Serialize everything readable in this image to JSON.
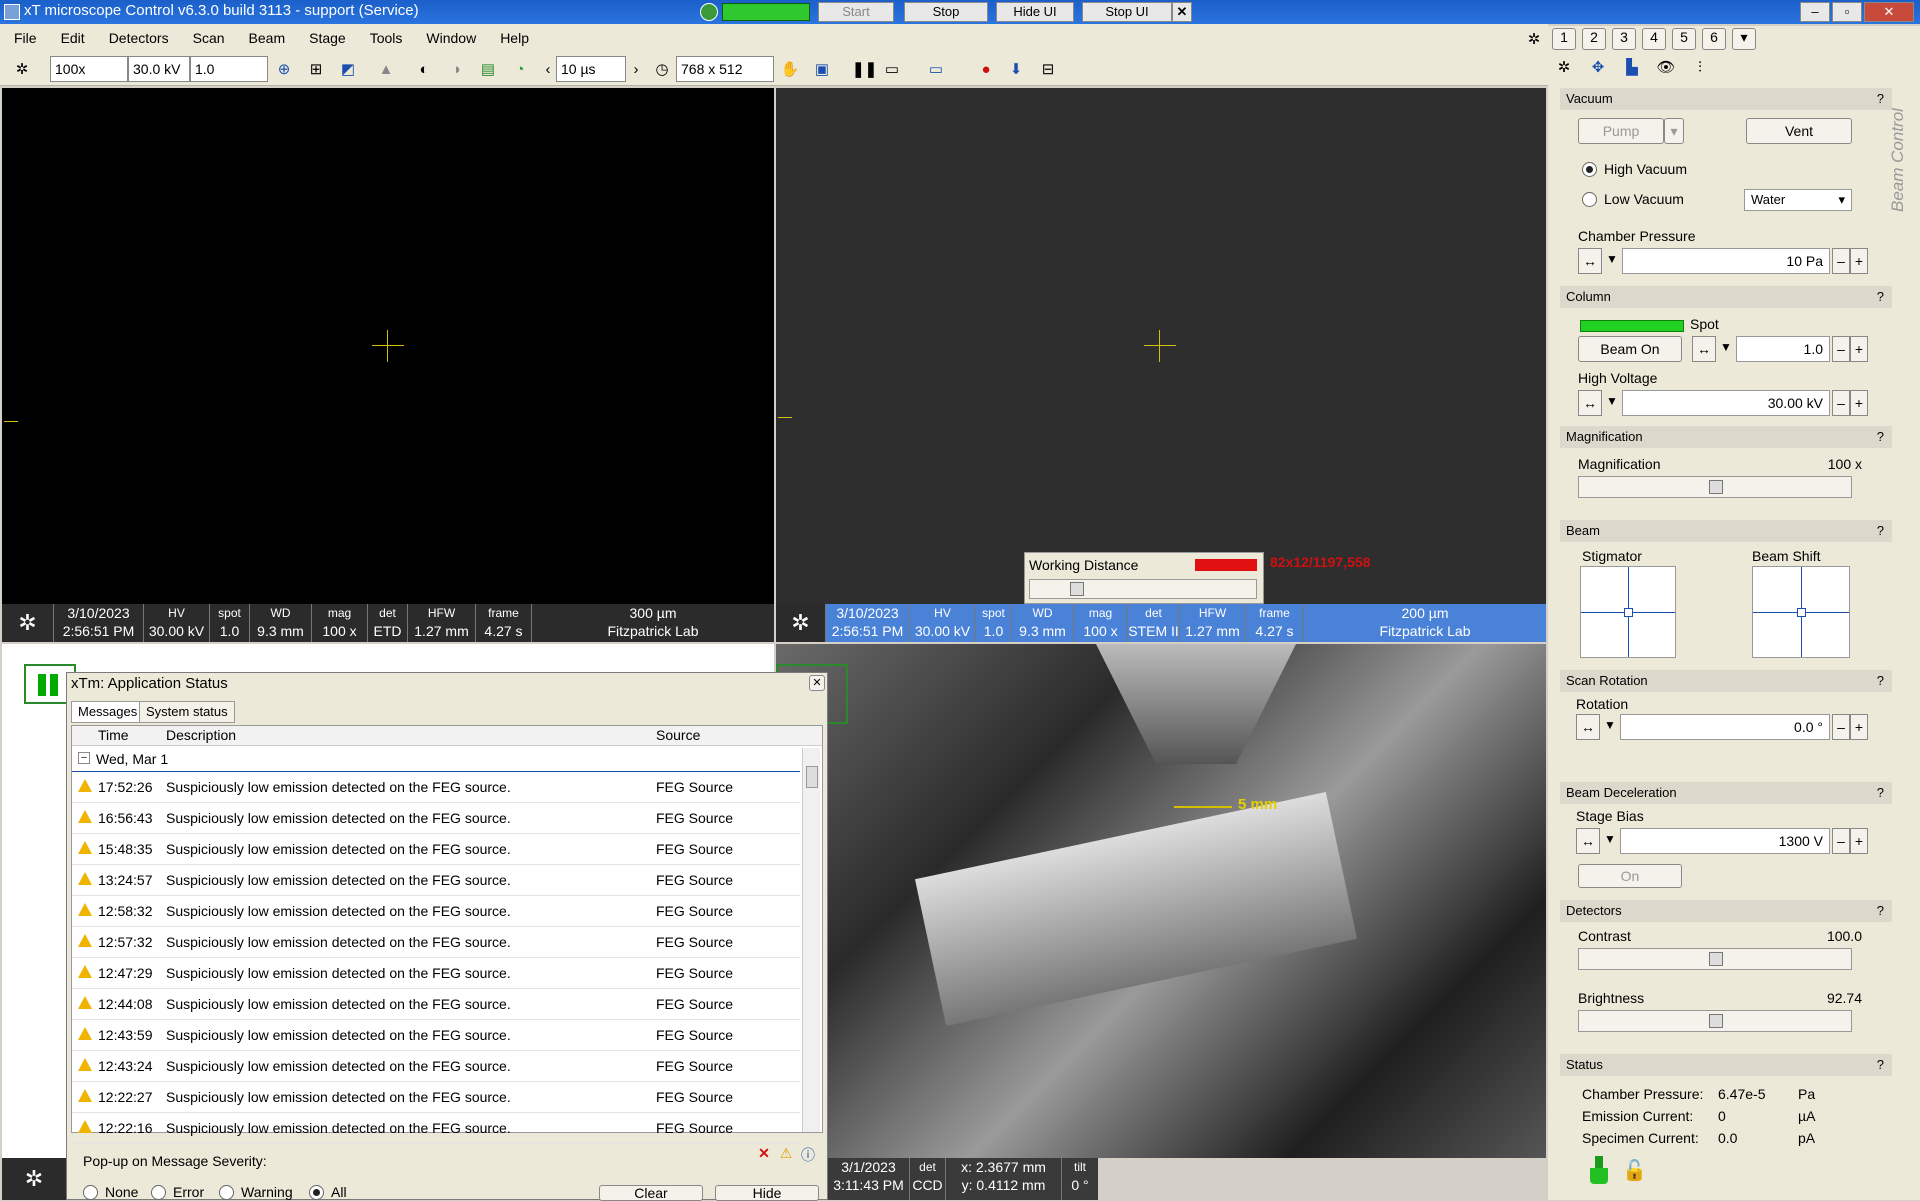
{
  "window": {
    "title": "xT microscope Control v6.3.0 build 3113 - support (Service)",
    "buttons": [
      "Start",
      "Stop",
      "Hide UI",
      "Stop UI"
    ]
  },
  "menu": [
    "File",
    "Edit",
    "Detectors",
    "Scan",
    "Beam",
    "Stage",
    "Tools",
    "Window",
    "Help"
  ],
  "toolbar": {
    "mag": "100x",
    "hv": "30.0 kV",
    "spot": "1.0",
    "dwell": "10 µs",
    "resolution": "768 x 512"
  },
  "quad_tabs": [
    "1",
    "2",
    "3",
    "4",
    "5",
    "6"
  ],
  "pane1": {
    "date": "3/10/2023",
    "time": "2:56:51 PM",
    "hv_k": "HV",
    "hv": "30.00 kV",
    "spot_k": "spot",
    "spot": "1.0",
    "wd_k": "WD",
    "wd": "9.3 mm",
    "mag_k": "mag",
    "mag": "100 x",
    "det_k": "det",
    "det": "ETD",
    "hfw_k": "HFW",
    "hfw": "1.27 mm",
    "frame_k": "frame",
    "frame": "4.27 s",
    "scale": "300 µm",
    "lab": "Fitzpatrick Lab"
  },
  "pane2": {
    "date": "3/10/2023",
    "time": "2:56:51 PM",
    "hv_k": "HV",
    "hv": "30.00 kV",
    "spot_k": "spot",
    "spot": "1.0",
    "wd_k": "WD",
    "wd": "9.3 mm",
    "mag_k": "mag",
    "mag": "100 x",
    "det_k": "det",
    "det": "STEM II",
    "hfw_k": "HFW",
    "hfw": "1.27 mm",
    "frame_k": "frame",
    "frame": "4.27 s",
    "scale": "200 µm",
    "lab": "Fitzpatrick Lab"
  },
  "wd_popup": {
    "title": "Working Distance",
    "readout": "82x12/1197,558"
  },
  "pane4": {
    "scale": "5 mm",
    "date": "3/1/2023",
    "time": "3:11:43 PM",
    "det_k": "det",
    "det": "CCD",
    "x": "x: 2.3677 mm",
    "y": "y: 0.4112 mm",
    "tilt_k": "tilt",
    "tilt": "0 °"
  },
  "dialog": {
    "title": "xTm: Application Status",
    "tabs": [
      "Messages",
      "System status"
    ],
    "columns": [
      "Time",
      "Description",
      "Source"
    ],
    "group": "Wed, Mar 1",
    "rows": [
      {
        "time": "17:52:26",
        "desc": "Suspiciously low emission detected on the FEG source.",
        "src": "FEG Source"
      },
      {
        "time": "16:56:43",
        "desc": "Suspiciously low emission detected on the FEG source.",
        "src": "FEG Source"
      },
      {
        "time": "15:48:35",
        "desc": "Suspiciously low emission detected on the FEG source.",
        "src": "FEG Source"
      },
      {
        "time": "13:24:57",
        "desc": "Suspiciously low emission detected on the FEG source.",
        "src": "FEG Source"
      },
      {
        "time": "12:58:32",
        "desc": "Suspiciously low emission detected on the FEG source.",
        "src": "FEG Source"
      },
      {
        "time": "12:57:32",
        "desc": "Suspiciously low emission detected on the FEG source.",
        "src": "FEG Source"
      },
      {
        "time": "12:47:29",
        "desc": "Suspiciously low emission detected on the FEG source.",
        "src": "FEG Source"
      },
      {
        "time": "12:44:08",
        "desc": "Suspiciously low emission detected on the FEG source.",
        "src": "FEG Source"
      },
      {
        "time": "12:43:59",
        "desc": "Suspiciously low emission detected on the FEG source.",
        "src": "FEG Source"
      },
      {
        "time": "12:43:24",
        "desc": "Suspiciously low emission detected on the FEG source.",
        "src": "FEG Source"
      },
      {
        "time": "12:22:27",
        "desc": "Suspiciously low emission detected on the FEG source.",
        "src": "FEG Source"
      },
      {
        "time": "12:22:16",
        "desc": "Suspiciously low emission detected on the FEG source.",
        "src": "FEG Source"
      }
    ],
    "popup_label": "Pop-up on Message Severity:",
    "severity": [
      "None",
      "Error",
      "Warning",
      "All"
    ],
    "clear": "Clear",
    "hide": "Hide"
  },
  "panel": {
    "side_label": "Beam Control",
    "vacuum": {
      "header": "Vacuum",
      "pump": "Pump",
      "vent": "Vent",
      "high": "High Vacuum",
      "low": "Low Vacuum",
      "gas": "Water",
      "pressure_label": "Chamber Pressure",
      "pressure": "10 Pa"
    },
    "column": {
      "header": "Column",
      "spot_label": "Spot",
      "beam_on": "Beam On",
      "spot": "1.0",
      "hv_label": "High Voltage",
      "hv": "30.00 kV"
    },
    "magnification": {
      "header": "Magnification",
      "label": "Magnification",
      "value": "100 x"
    },
    "beam": {
      "header": "Beam",
      "stigmator": "Stigmator",
      "shift": "Beam Shift"
    },
    "scan_rotation": {
      "header": "Scan Rotation",
      "label": "Rotation",
      "value": "0.0 °"
    },
    "decel": {
      "header": "Beam Deceleration",
      "label": "Stage Bias",
      "value": "1300 V",
      "on": "On"
    },
    "detectors": {
      "header": "Detectors",
      "contrast_label": "Contrast",
      "contrast": "100.0",
      "brightness_label": "Brightness",
      "brightness": "92.74"
    },
    "status": {
      "header": "Status",
      "cp_label": "Chamber Pressure:",
      "cp": "6.47e-5",
      "cp_unit": "Pa",
      "ec_label": "Emission Current:",
      "ec": "0",
      "ec_unit": "µA",
      "sc_label": "Specimen Current:",
      "sc": "0.0",
      "sc_unit": "pA"
    },
    "help": "?"
  }
}
